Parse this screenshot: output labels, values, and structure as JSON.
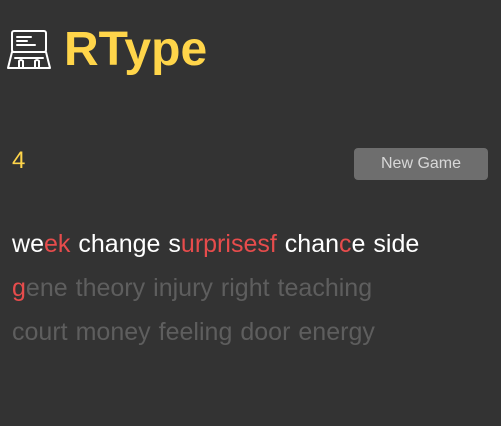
{
  "app": {
    "title": "RType",
    "logo_icon": "laptop-typing-icon",
    "accent_color": "#ffd54a"
  },
  "game": {
    "score": "4",
    "new_game_label": "New Game"
  },
  "words": [
    {
      "word": "week",
      "state": "typed",
      "errors": [
        2,
        3
      ]
    },
    {
      "word": "change",
      "state": "typed",
      "errors": []
    },
    {
      "word": "surprisesf",
      "state": "typed",
      "errors": [
        1,
        2,
        3,
        4,
        5,
        6,
        7,
        8,
        9
      ]
    },
    {
      "word": "chance",
      "state": "typed",
      "errors": [
        4
      ]
    },
    {
      "word": "side",
      "state": "typed",
      "errors": []
    },
    {
      "word": "gene",
      "state": "current",
      "errors": [
        0
      ]
    },
    {
      "word": "theory",
      "state": "pending",
      "errors": []
    },
    {
      "word": "injury",
      "state": "pending",
      "errors": []
    },
    {
      "word": "right",
      "state": "pending",
      "errors": []
    },
    {
      "word": "teaching",
      "state": "pending",
      "errors": []
    },
    {
      "word": "court",
      "state": "pending",
      "errors": []
    },
    {
      "word": "money",
      "state": "pending",
      "errors": []
    },
    {
      "word": "feeling",
      "state": "pending",
      "errors": []
    },
    {
      "word": "door",
      "state": "pending",
      "errors": []
    },
    {
      "word": "energy",
      "state": "pending",
      "errors": []
    }
  ],
  "colors": {
    "typed": "#ffffff",
    "error": "#e74c4c",
    "pending": "#5e5e5e"
  }
}
